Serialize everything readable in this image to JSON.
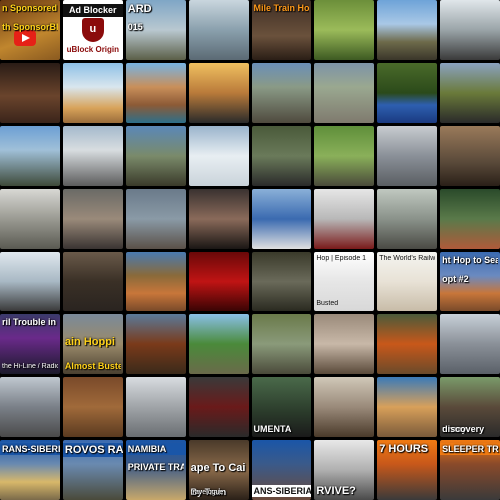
{
  "colors": {
    "background": "#000000",
    "youtube_red": "#e62117",
    "ublock_red": "#8b0b0b"
  },
  "tiles": [
    {
      "bg": "linear-gradient(160deg,#6a3a12,#c0862e 60%,#8a5a20)",
      "icon": "youtube-icon",
      "caps": [
        {
          "text": "n Sponsored",
          "cls": "top yellow"
        },
        {
          "text": "th SponsorBl",
          "cls": "mid yellow"
        }
      ]
    },
    {
      "bg": "#ffffff",
      "special": "ublock",
      "label": "Ad Blocker",
      "name": "uBlock Origin"
    },
    {
      "bg": "linear-gradient(180deg,#7fa6c6,#b9c8d0 50%,#5b5f48)",
      "caps": [
        {
          "text": "ARD",
          "cls": "top big"
        },
        {
          "text": "015",
          "cls": "mid"
        }
      ]
    },
    {
      "bg": "linear-gradient(180deg,#c9d6de,#8aa0ad 50%,#5b6a74)",
      "caps": []
    },
    {
      "bg": "linear-gradient(180deg,#3e2e24,#6a513c 60%,#2a1e16)",
      "caps": [
        {
          "text": "Mile Train Hop",
          "cls": "top orange"
        }
      ]
    },
    {
      "bg": "linear-gradient(180deg,#6c8f3a,#9bbb5a 50%,#3d5a22)",
      "caps": []
    },
    {
      "bg": "linear-gradient(180deg,#6ea3d8,#a9c8e6 40%,#6d6a4a 70%,#3a362a)",
      "caps": []
    },
    {
      "bg": "linear-gradient(180deg,#e0e6ea,#9aa4a8 50%,#3a3a3a)",
      "caps": []
    },
    {
      "bg": "linear-gradient(180deg,#2a1c16,#6a442c 55%,#3a241a)",
      "caps": []
    },
    {
      "bg": "linear-gradient(180deg,#8ec0e6,#d9e6ee 40%,#d8a35a 75%,#9a6c3a)",
      "caps": []
    },
    {
      "bg": "linear-gradient(180deg,#77b3e3,#c98f5a 40%,#8c5a36 70%,#2d6f8a)",
      "caps": []
    },
    {
      "bg": "linear-gradient(180deg,#f0c060,#b97a3a 50%,#2a2a2a)",
      "caps": []
    },
    {
      "bg": "linear-gradient(180deg,#6a8fb8,#8a9a86 40%,#4f4a3e)",
      "caps": []
    },
    {
      "bg": "linear-gradient(180deg,#7d93a8,#9aa890 40%,#7f7a6e)",
      "caps": []
    },
    {
      "bg": "linear-gradient(180deg,#4a6a2a,#2b4a1a 50%,#2e5fb0 70%,#1a3a80)",
      "caps": []
    },
    {
      "bg": "linear-gradient(180deg,#8aa2c0,#6a7a3a 50%,#2a2a2a)",
      "caps": []
    },
    {
      "bg": "linear-gradient(180deg,#6c9fd4,#a0c0d8 40%,#3e4a3a)",
      "caps": []
    },
    {
      "bg": "linear-gradient(180deg,#a4b9cc,#d8dde0 40%,#5c5c5c)",
      "caps": []
    },
    {
      "bg": "linear-gradient(180deg,#5a88b8,#7a8a6a 50%,#3a3a2a)",
      "caps": []
    },
    {
      "bg": "linear-gradient(180deg,#9ab4cc,#e8eef2 50%,#c9d3da)",
      "caps": []
    },
    {
      "bg": "linear-gradient(180deg,#4a5a3a,#6a7a5a 50%,#2a2a2a)",
      "caps": []
    },
    {
      "bg": "linear-gradient(180deg,#5f8f3a,#8ab05a 50%,#4a4a3a)",
      "caps": []
    },
    {
      "bg": "linear-gradient(180deg,#c8ccd0,#8a9098 50%,#5a5e62)",
      "caps": []
    },
    {
      "bg": "linear-gradient(180deg,#9a7a5a,#5a4a3a 60%,#2a2018)",
      "caps": []
    },
    {
      "bg": "linear-gradient(180deg,#d8d8d4,#9a9a92 50%,#5a5a52)",
      "caps": []
    },
    {
      "bg": "linear-gradient(180deg,#6a6a66,#9a8a7a 50%,#3a3432)",
      "caps": []
    },
    {
      "bg": "linear-gradient(180deg,#6a7a8a,#8a9aa6 50%,#5a5048)",
      "caps": []
    },
    {
      "bg": "linear-gradient(180deg,#3a3230,#8a6a5a 50%,#1a1614)",
      "caps": []
    },
    {
      "bg": "linear-gradient(180deg,#8ab0d8,#3a6ab0 50%,#e0e0e0)",
      "caps": []
    },
    {
      "bg": "linear-gradient(180deg,#e6e6e6,#b8b8b8 50%,#7a1a1a)",
      "caps": []
    },
    {
      "bg": "linear-gradient(180deg,#c0c8c0,#8a928a 50%,#4a4a44)",
      "caps": []
    },
    {
      "bg": "linear-gradient(180deg,#2a4a2a,#5a7a4a 50%,#b05a3a)",
      "caps": []
    },
    {
      "bg": "linear-gradient(180deg,#e0e8ee,#a8b8c4 50%,#3a3a3a)",
      "caps": []
    },
    {
      "bg": "linear-gradient(180deg,#6a5a4a,#3a3026 50%,#2a2420)",
      "caps": []
    },
    {
      "bg": "linear-gradient(180deg,#4a7ab0,#8a6a3a 40%,#c8763a 70%,#7a4a2a)",
      "caps": []
    },
    {
      "bg": "linear-gradient(180deg,#6a0808,#c01414 50%,#3a0404)",
      "caps": []
    },
    {
      "bg": "linear-gradient(180deg,#3a3a2a,#6a6a5a 50%,#2a2a20)",
      "caps": []
    },
    {
      "bg": "linear-gradient(180deg,#ffffff,#e6e6e6 50%,#d8d8d8)",
      "caps": [
        {
          "text": "Hop | Episode 1",
          "cls": "top dark sm"
        },
        {
          "text": "Busted",
          "cls": "bot dark sm"
        }
      ]
    },
    {
      "bg": "linear-gradient(180deg,#f4f4f0,#e8e2d6 50%,#c8bca8)",
      "caps": [
        {
          "text": "The World's Railway",
          "cls": "top dark sm"
        }
      ]
    },
    {
      "bg": "linear-gradient(180deg,#3a6ab0,#6a8ac0 40%,#c8763a 70%,#7a4a2a)",
      "caps": [
        {
          "text": "ht Hop to Seattle",
          "cls": "top"
        },
        {
          "text": "opt #2",
          "cls": "mid"
        }
      ]
    },
    {
      "bg": "linear-gradient(180deg,#3a3a6a,#6a2a8a 40%,#1a1a2a)",
      "caps": [
        {
          "text": "ril Trouble in St. Paul",
          "cls": "top"
        },
        {
          "text": "the Hi-Line / Radio Give Away",
          "cls": "bot sm"
        }
      ]
    },
    {
      "bg": "linear-gradient(180deg,#7a8a9a,#9a8a6a 50%,#4a4030)",
      "caps": [
        {
          "text": "ain Hoppi",
          "cls": "mid big yellow"
        },
        {
          "text": "Almost Busted",
          "cls": "bot yellow"
        }
      ]
    },
    {
      "bg": "linear-gradient(180deg,#5a7a9a,#7a3a1a 50%,#3a2a1a)",
      "caps": []
    },
    {
      "bg": "linear-gradient(180deg,#8ac0e8,#4a8a3a 50%,#6a6a4a)",
      "caps": []
    },
    {
      "bg": "linear-gradient(180deg,#6a7a4a,#8a9a7a 50%,#4a4a3a)",
      "caps": []
    },
    {
      "bg": "linear-gradient(180deg,#9a8a7a,#c8b8a8 50%,#5a4a3a)",
      "caps": []
    },
    {
      "bg": "linear-gradient(180deg,#4a5a3a,#c8581a 50%,#6a4a2a)",
      "caps": []
    },
    {
      "bg": "linear-gradient(180deg,#c8d0d8,#8a9098 50%,#5a6068)",
      "caps": []
    },
    {
      "bg": "linear-gradient(180deg,#c0c8d0,#7a8088 50%,#4a4a4a)",
      "caps": []
    },
    {
      "bg": "linear-gradient(180deg,#7a4a2a,#a06a3a 50%,#5a3a20)",
      "caps": []
    },
    {
      "bg": "linear-gradient(180deg,#d8dce0,#a0a4a8 50%,#6a6e72)",
      "caps": []
    },
    {
      "bg": "linear-gradient(180deg,#3a3a3a,#6a1a1a 50%,#2a2a2a)",
      "caps": []
    },
    {
      "bg": "linear-gradient(180deg,#4a6a4a,#2a3a2a 60%,#1a1a1a)",
      "caps": [
        {
          "text": "UMENTA",
          "cls": "bot"
        }
      ]
    },
    {
      "bg": "linear-gradient(180deg,#d0c8b8,#9a8a7a 50%,#4a3a2a)",
      "caps": []
    },
    {
      "bg": "linear-gradient(180deg,#3a7ab8,#d8a05a 50%,#7a5a3a)",
      "caps": []
    },
    {
      "bg": "linear-gradient(180deg,#7a9a6a,#5a4a3a 50%,#2a2a2a)",
      "caps": [
        {
          "text": "urney",
          "cls": "bot"
        },
        {
          "text": "discovery",
          "cls": "bot"
        }
      ]
    },
    {
      "bg": "linear-gradient(180deg,#1a56a8,#6a8ab0 40%,#d8b86a 70%,#7a6a4a)",
      "caps": [
        {
          "text": "RANS-SIBERIA",
          "cls": "top bg-blue"
        }
      ]
    },
    {
      "bg": "linear-gradient(180deg,#3a6ab0,#6a8ab0 40%,#4a4a3a)",
      "caps": [
        {
          "text": "ROVOS RAIL",
          "cls": "top bg-blue big"
        }
      ]
    },
    {
      "bg": "linear-gradient(180deg,#1a56a8,#3a5a8a 40%,#c8a86a)",
      "caps": [
        {
          "text": "NAMIBIA",
          "cls": "top bg-blue"
        },
        {
          "text": "PRIVATE TRA",
          "cls": "mid"
        }
      ]
    },
    {
      "bg": "linear-gradient(180deg,#4a3a2a,#8a6a4a 50%,#2a2018)",
      "caps": [
        {
          "text": "ape To Cai",
          "cls": "mid big"
        },
        {
          "text": "By Train",
          "cls": "bot"
        },
        {
          "text": "travelogue",
          "cls": "bot sm"
        }
      ]
    },
    {
      "bg": "linear-gradient(180deg,#1a56a8,#3a5a8a 40%,#6a4a3a)",
      "caps": [
        {
          "text": "ANS-SIBERIAN",
          "cls": "bot bg-white"
        }
      ]
    },
    {
      "bg": "linear-gradient(180deg,#e8e8e8,#b0b0b0 50%,#4a4a4a)",
      "caps": [
        {
          "text": "RVIVE?",
          "cls": "bot big"
        }
      ]
    },
    {
      "bg": "linear-gradient(180deg,#f07a12,#c8581a 40%,#3a3a3a)",
      "caps": [
        {
          "text": "7 HOURS",
          "cls": "top big"
        }
      ]
    },
    {
      "bg": "linear-gradient(180deg,#f07a12,#8a4a2a 40%,#3a3a3a)",
      "caps": [
        {
          "text": "SLEEPER TR",
          "cls": "top bg-orange"
        }
      ]
    }
  ]
}
